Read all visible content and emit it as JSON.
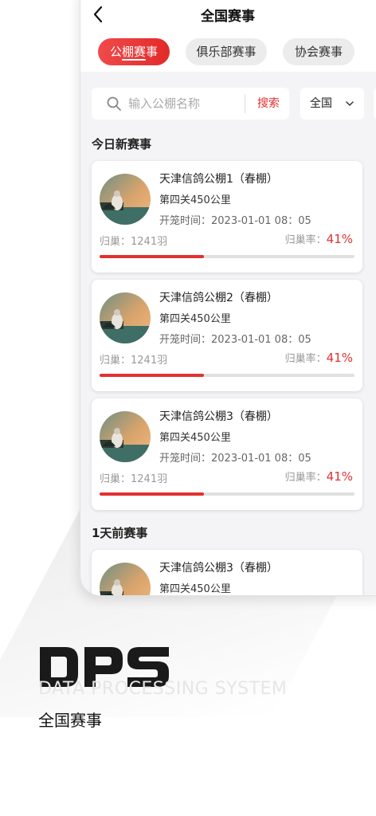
{
  "header": {
    "title": "全国赛事",
    "back_icon": "chevron-left-icon"
  },
  "tabs": [
    {
      "label": "公棚赛事",
      "active": true
    },
    {
      "label": "俱乐部赛事",
      "active": false
    },
    {
      "label": "协会赛事",
      "active": false
    }
  ],
  "search": {
    "placeholder": "输入公棚名称",
    "button_label": "搜索",
    "region": "全国"
  },
  "sections": [
    {
      "title": "今日新赛事"
    },
    {
      "title": "1天前赛事"
    }
  ],
  "cards": [
    {
      "title": "天津信鸽公棚1（春棚）",
      "stage": "第四关450公里",
      "start_time": "开笼时间：2023-01-01 08：05",
      "returned": "归巢：1241羽",
      "rate_label": "归巢率：",
      "rate_value": "41%",
      "rate": 0.41
    },
    {
      "title": "天津信鸽公棚2（春棚）",
      "stage": "第四关450公里",
      "start_time": "开笼时间：2023-01-01 08：05",
      "returned": "归巢：1241羽",
      "rate_label": "归巢率：",
      "rate_value": "41%",
      "rate": 0.41
    },
    {
      "title": "天津信鸽公棚3（春棚）",
      "stage": "第四关450公里",
      "start_time": "开笼时间：2023-01-01 08：05",
      "returned": "归巢：1241羽",
      "rate_label": "归巢率：",
      "rate_value": "41%",
      "rate": 0.41
    },
    {
      "title": "天津信鸽公棚3（春棚）",
      "stage": "第四关450公里"
    }
  ],
  "branding": {
    "logo_text": "DPS",
    "logo_subtitle": "DATA PROCESSING SYSTEM",
    "caption": "全国赛事"
  },
  "colors": {
    "accent": "#e23030",
    "background": "#f4f4f6"
  }
}
